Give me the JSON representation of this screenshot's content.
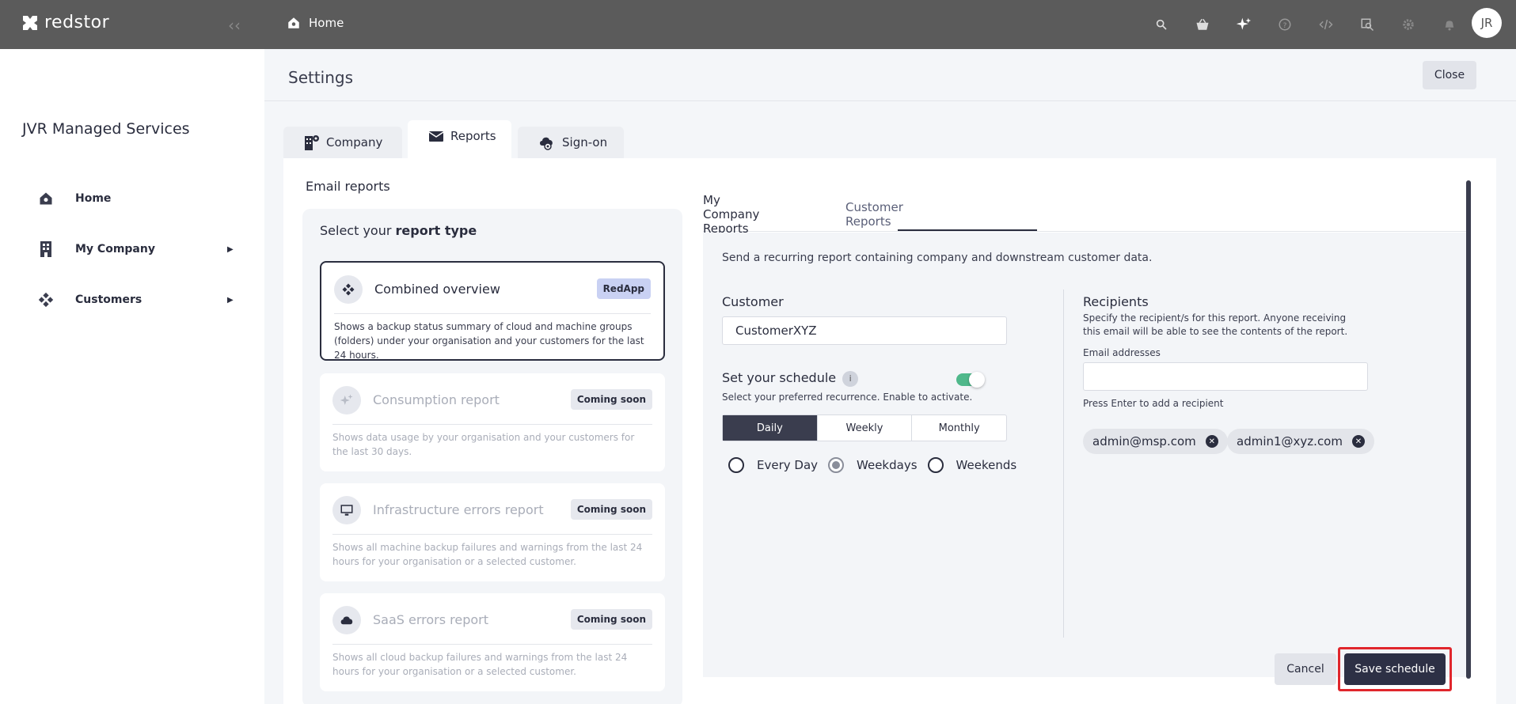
{
  "brand": {
    "name": "redstor"
  },
  "topbar": {
    "breadcrumb": "Home",
    "icons": [
      "search-icon",
      "basket-icon",
      "sparkle-icon",
      "help-icon",
      "code-icon",
      "inspect-icon",
      "gear-icon",
      "bell-icon"
    ],
    "avatar_initials": "JR"
  },
  "sidebar": {
    "company": "JVR Managed Services",
    "items": [
      {
        "label": "Home",
        "icon": "home-icon",
        "expandable": false
      },
      {
        "label": "My Company",
        "icon": "building-icon",
        "expandable": true
      },
      {
        "label": "Customers",
        "icon": "customers-icon",
        "expandable": true
      }
    ]
  },
  "header": {
    "title": "Settings",
    "close_label": "Close"
  },
  "tabs": [
    {
      "label": "Company",
      "active": false
    },
    {
      "label": "Reports",
      "active": true
    },
    {
      "label": "Sign-on",
      "active": false
    }
  ],
  "section_title": "Email reports",
  "report_type": {
    "heading_prefix": "Select your ",
    "heading_bold": "report type",
    "cards": [
      {
        "title": "Combined overview",
        "badge": "RedApp",
        "desc": "Shows a backup status summary of cloud and machine groups (folders) under your organisation and your customers for the last 24 hours.",
        "selected": true,
        "disabled": false
      },
      {
        "title": "Consumption report",
        "badge": "Coming soon",
        "desc": "Shows data usage by your organisation and your customers for the last 30 days.",
        "selected": false,
        "disabled": true
      },
      {
        "title": "Infrastructure errors report",
        "badge": "Coming soon",
        "desc": "Shows all machine backup failures and warnings from the last 24 hours for your organisation or a selected customer.",
        "selected": false,
        "disabled": true
      },
      {
        "title": "SaaS errors report",
        "badge": "Coming soon",
        "desc": "Shows all cloud backup failures and warnings from the last 24 hours for your organisation or a selected customer.",
        "selected": false,
        "disabled": true
      }
    ]
  },
  "subtabs": [
    {
      "label": "My Company Reports",
      "active": false
    },
    {
      "label": "Customer Reports",
      "active": true
    }
  ],
  "form": {
    "description": "Send a recurring report containing company and downstream customer data.",
    "customer_label": "Customer",
    "customer_value": "CustomerXYZ",
    "schedule_label": "Set your schedule",
    "schedule_info": "i",
    "schedule_hint": "Select your preferred recurrence. Enable to activate.",
    "schedule_enabled": true,
    "recurrence": [
      "Daily",
      "Weekly",
      "Monthly"
    ],
    "recurrence_selected": "Daily",
    "day_options": [
      "Every Day",
      "Weekdays",
      "Weekends"
    ],
    "day_selected": "Weekdays",
    "recipients_label": "Recipients",
    "recipients_hint": "Specify the recipient/s for this report. Anyone receiving this email will be able to see the contents of the report.",
    "email_label": "Email addresses",
    "email_value": "",
    "email_help": "Press Enter to add a recipient",
    "recipients": [
      "admin@msp.com",
      "admin1@xyz.com"
    ],
    "cancel_label": "Cancel",
    "save_label": "Save schedule"
  },
  "colors": {
    "topbar": "#5b5b5b",
    "accent_dark": "#2d3045",
    "toggle_on": "#4fb88b",
    "highlight_border": "#e0262c",
    "badge_redapp": "#c9d1f3"
  }
}
